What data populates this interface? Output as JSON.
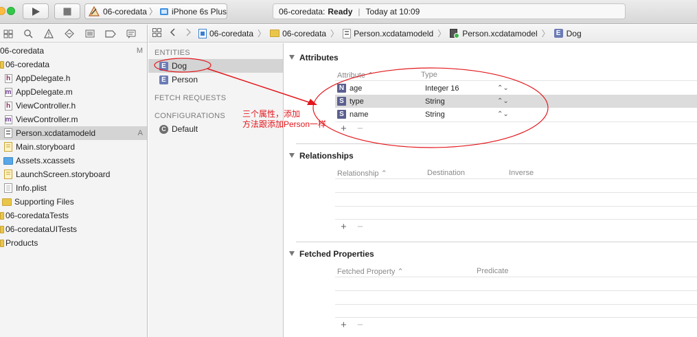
{
  "toolbar": {
    "scheme_project": "06-coredata",
    "scheme_device": "iPhone 6s Plus",
    "status_project": "06-coredata:",
    "status_state": "Ready",
    "status_separator": "|",
    "status_time": "Today at 10:09",
    "colors": {
      "close": "#fc605c",
      "minimize": "#fdbc40",
      "zoom": "#34c84a"
    }
  },
  "navigator": {
    "items": [
      {
        "label": "06-coredata",
        "icon": "project-icon",
        "badge": "M",
        "selected": false
      },
      {
        "label": "06-coredata",
        "icon": "folder-icon",
        "badge": "",
        "selected": false
      },
      {
        "label": "AppDelegate.h",
        "icon": "header-file-icon",
        "glyph": "h",
        "badge": "",
        "selected": false
      },
      {
        "label": "AppDelegate.m",
        "icon": "source-file-icon",
        "glyph": "m",
        "badge": "",
        "selected": false
      },
      {
        "label": "ViewController.h",
        "icon": "header-file-icon",
        "glyph": "h",
        "badge": "",
        "selected": false
      },
      {
        "label": "ViewController.m",
        "icon": "source-file-icon",
        "glyph": "m",
        "badge": "",
        "selected": false
      },
      {
        "label": "Person.xcdatamodeld",
        "icon": "datamodel-icon",
        "badge": "A",
        "selected": true
      },
      {
        "label": "Main.storyboard",
        "icon": "storyboard-icon",
        "badge": "",
        "selected": false
      },
      {
        "label": "Assets.xcassets",
        "icon": "assets-icon",
        "badge": "",
        "selected": false
      },
      {
        "label": "LaunchScreen.storyboard",
        "icon": "storyboard-icon",
        "badge": "",
        "selected": false
      },
      {
        "label": "Info.plist",
        "icon": "plist-icon",
        "badge": "",
        "selected": false
      },
      {
        "label": "Supporting Files",
        "icon": "folder-icon",
        "badge": "",
        "selected": false
      },
      {
        "label": "06-coredataTests",
        "icon": "folder-icon",
        "badge": "",
        "selected": false
      },
      {
        "label": "06-coredataUITests",
        "icon": "folder-icon",
        "badge": "",
        "selected": false
      },
      {
        "label": "Products",
        "icon": "folder-icon",
        "badge": "",
        "selected": false
      }
    ]
  },
  "jumpbar": {
    "crumbs": [
      "06-coredata",
      "06-coredata",
      "Person.xcdatamodeld",
      "Person.xcdatamodel",
      "Dog"
    ]
  },
  "entities": {
    "entities_title": "ENTITIES",
    "items": [
      {
        "label": "Dog",
        "glyph": "E",
        "selected": true
      },
      {
        "label": "Person",
        "glyph": "E",
        "selected": false
      }
    ],
    "fetch_requests_title": "FETCH REQUESTS",
    "configurations_title": "CONFIGURATIONS",
    "configurations": [
      {
        "label": "Default",
        "glyph": "C"
      }
    ]
  },
  "attributes": {
    "title": "Attributes",
    "col_attribute": "Attribute",
    "col_type": "Type",
    "rows": [
      {
        "glyph": "N",
        "name": "age",
        "type": "Integer 16",
        "selected": false
      },
      {
        "glyph": "S",
        "name": "type",
        "type": "String",
        "selected": true
      },
      {
        "glyph": "S",
        "name": "name",
        "type": "String",
        "selected": false
      }
    ]
  },
  "relationships": {
    "title": "Relationships",
    "col_relationship": "Relationship",
    "col_destination": "Destination",
    "col_inverse": "Inverse"
  },
  "fetched_properties": {
    "title": "Fetched Properties",
    "col_property": "Fetched Property",
    "col_predicate": "Predicate"
  },
  "annotation": {
    "line1": "三个属性，添加",
    "line2": "方法跟添加Person一样",
    "color": "#e3161b"
  },
  "controls": {
    "add": "+",
    "remove": "−",
    "sort_asc": "⌃",
    "stepper": "⌃⌄"
  }
}
